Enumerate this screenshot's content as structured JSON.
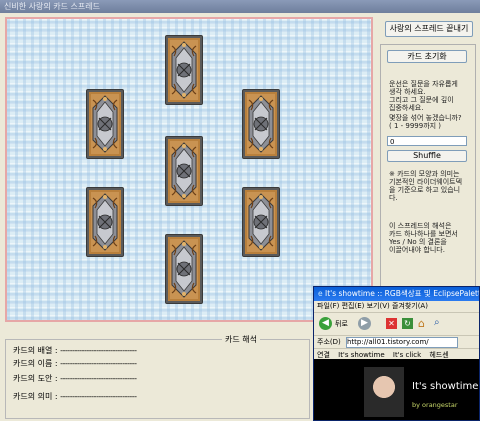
{
  "window": {
    "title": "신비한 사랑의 카드 스프레드"
  },
  "side": {
    "spread_button": "사랑의 스프레드 끝내기",
    "reset_button": "카드 초기화",
    "instructions": [
      "운선은 질문을 자유롭게",
      "생각 하세요.",
      "그리고 그 질문에 깊이",
      "집중하세요."
    ],
    "shuffle_question": [
      "몇장을 섞어 놓겠습니까?",
      "( 1 - 9999까지 )"
    ],
    "shuffle_value": "0",
    "shuffle_button": "Shuffle",
    "note1": [
      "※ 카드의 모양과 의미는",
      "기본적인 라이더웨이트덱",
      "을 기준으로 하고 있습니",
      "다."
    ],
    "note2": [
      "이 스프레드의 해석은",
      "카드 하나하나를 보면서",
      "Yes / No 의 결론을",
      "이끌어내야 합니다."
    ]
  },
  "interpretation": {
    "title": "카드 해석",
    "rows": [
      {
        "label": "카드의 배열 :",
        "value": "--------------------------------"
      },
      {
        "label": "카드의 이름 :",
        "value": "--------------------------------"
      },
      {
        "label": "카드의 도안 :",
        "value": "--------------------------------"
      },
      {
        "label": "카드의 의미 :",
        "value": "--------------------------------"
      }
    ]
  },
  "browser": {
    "title": "It's showtime :: RGB색상표 및 EclipsePalette",
    "menu": "파일(F)  편집(E)  보기(V)  즐겨찾기(A)",
    "back_label": "뒤로",
    "address_label": "주소(D)",
    "address_value": "http://all01.tistory.com/",
    "links_label": "연결",
    "links": [
      "It's showtime",
      "It's click",
      "헤드센"
    ],
    "page_heading": "It's showtime",
    "page_byline": "by orangestar"
  }
}
